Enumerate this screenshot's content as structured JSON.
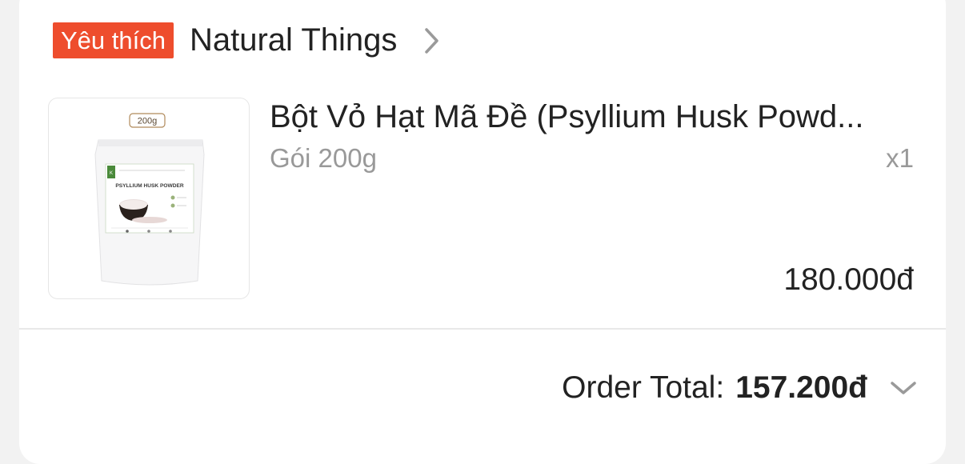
{
  "shop": {
    "badge": "Yêu thích",
    "name": "Natural Things"
  },
  "item": {
    "title": "Bột Vỏ Hạt Mã Đề (Psyllium Husk Powd...",
    "variant": "Gói 200g",
    "quantity": "x1",
    "price": "180.000đ",
    "image": {
      "tag": "200g",
      "label": "PSYLLIUM HUSK POWDER"
    }
  },
  "order": {
    "total_label": "Order Total:",
    "total_value": "157.200đ"
  },
  "colors": {
    "badge_bg": "#ee4d2d",
    "text": "#222222",
    "muted": "#999999"
  },
  "icons": {
    "shop_chevron": "chevron-right-icon",
    "total_expand": "chevron-down-icon"
  }
}
